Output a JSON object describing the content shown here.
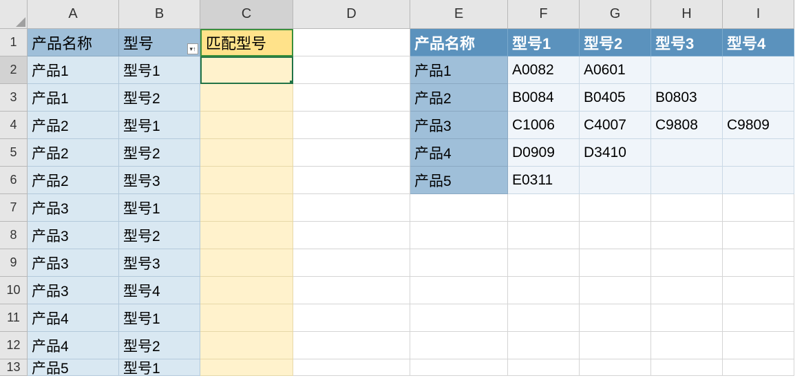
{
  "columns": [
    "A",
    "B",
    "C",
    "D",
    "E",
    "F",
    "G",
    "H",
    "I"
  ],
  "rowCount": 13,
  "left": {
    "headers": [
      "产品名称",
      "型号"
    ],
    "matchHeader": "匹配型号",
    "rows": [
      [
        "产品1",
        "型号1"
      ],
      [
        "产品1",
        "型号2"
      ],
      [
        "产品2",
        "型号1"
      ],
      [
        "产品2",
        "型号2"
      ],
      [
        "产品2",
        "型号3"
      ],
      [
        "产品3",
        "型号1"
      ],
      [
        "产品3",
        "型号2"
      ],
      [
        "产品3",
        "型号3"
      ],
      [
        "产品3",
        "型号4"
      ],
      [
        "产品4",
        "型号1"
      ],
      [
        "产品4",
        "型号2"
      ],
      [
        "产品5",
        "型号1"
      ]
    ]
  },
  "right": {
    "headers": [
      "产品名称",
      "型号1",
      "型号2",
      "型号3",
      "型号4"
    ],
    "rows": [
      [
        "产品1",
        "A0082",
        "A0601",
        "",
        ""
      ],
      [
        "产品2",
        "B0084",
        "B0405",
        "B0803",
        ""
      ],
      [
        "产品3",
        "C1006",
        "C4007",
        "C9808",
        "C9809"
      ],
      [
        "产品4",
        "D0909",
        "D3410",
        "",
        ""
      ],
      [
        "产品5",
        "E0311",
        "",
        "",
        ""
      ]
    ]
  },
  "active": {
    "row": 2,
    "col": "C"
  },
  "chart_data": {
    "type": "table",
    "title": "产品型号匹配表",
    "left_table": {
      "columns": [
        "产品名称",
        "型号",
        "匹配型号"
      ],
      "data": [
        [
          "产品1",
          "型号1",
          ""
        ],
        [
          "产品1",
          "型号2",
          ""
        ],
        [
          "产品2",
          "型号1",
          ""
        ],
        [
          "产品2",
          "型号2",
          ""
        ],
        [
          "产品2",
          "型号3",
          ""
        ],
        [
          "产品3",
          "型号1",
          ""
        ],
        [
          "产品3",
          "型号2",
          ""
        ],
        [
          "产品3",
          "型号3",
          ""
        ],
        [
          "产品3",
          "型号4",
          ""
        ],
        [
          "产品4",
          "型号1",
          ""
        ],
        [
          "产品4",
          "型号2",
          ""
        ],
        [
          "产品5",
          "型号1",
          ""
        ]
      ]
    },
    "right_table": {
      "columns": [
        "产品名称",
        "型号1",
        "型号2",
        "型号3",
        "型号4"
      ],
      "data": [
        [
          "产品1",
          "A0082",
          "A0601",
          "",
          ""
        ],
        [
          "产品2",
          "B0084",
          "B0405",
          "B0803",
          ""
        ],
        [
          "产品3",
          "C1006",
          "C4007",
          "C9808",
          "C9809"
        ],
        [
          "产品4",
          "D0909",
          "D3410",
          "",
          ""
        ],
        [
          "产品5",
          "E0311",
          "",
          "",
          ""
        ]
      ]
    }
  }
}
